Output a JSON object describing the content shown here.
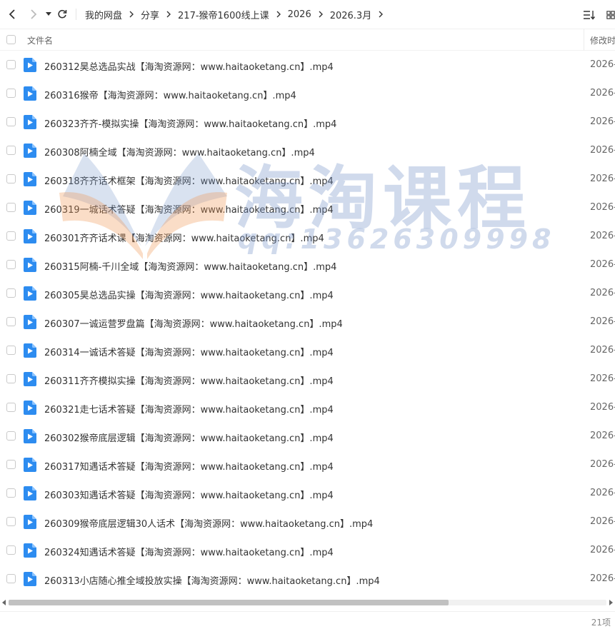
{
  "breadcrumb": [
    "我的网盘",
    "分享",
    "217-猴帝1600线上课",
    "2026",
    "2026.3月"
  ],
  "header": {
    "name_label": "文件名",
    "modified_label": "修改时"
  },
  "files": [
    {
      "name": "260312昊总选品实战【海淘资源网：www.haitaoketang.cn】.mp4",
      "date": "2026-0"
    },
    {
      "name": "260316猴帝【海淘资源网：www.haitaoketang.cn】.mp4",
      "date": "2026-0"
    },
    {
      "name": "260323齐齐-模拟实操【海淘资源网：www.haitaoketang.cn】.mp4",
      "date": "2026-0"
    },
    {
      "name": "260308阿楠全域【海淘资源网：www.haitaoketang.cn】.mp4",
      "date": "2026-0"
    },
    {
      "name": "260318齐齐话术框架【海淘资源网：www.haitaoketang.cn】.mp4",
      "date": "2026-0"
    },
    {
      "name": "260319一城话术答疑【海淘资源网：www.haitaoketang.cn】.mp4",
      "date": "2026-0"
    },
    {
      "name": "260301齐齐话术课【海淘资源网：www.haitaoketang.cn】.mp4",
      "date": "2026-0"
    },
    {
      "name": "260315阿楠-千川全域【海淘资源网：www.haitaoketang.cn】.mp4",
      "date": "2026-0"
    },
    {
      "name": "260305昊总选品实操【海淘资源网：www.haitaoketang.cn】.mp4",
      "date": "2026-0"
    },
    {
      "name": "260307一诚运营罗盘篇【海淘资源网：www.haitaoketang.cn】.mp4",
      "date": "2026-0"
    },
    {
      "name": "260314一诚话术答疑【海淘资源网：www.haitaoketang.cn】.mp4",
      "date": "2026-0"
    },
    {
      "name": "260311齐齐模拟实操【海淘资源网：www.haitaoketang.cn】.mp4",
      "date": "2026-0"
    },
    {
      "name": "260321走七话术答疑【海淘资源网：www.haitaoketang.cn】.mp4",
      "date": "2026-0"
    },
    {
      "name": "260302猴帝底层逻辑【海淘资源网：www.haitaoketang.cn】.mp4",
      "date": "2026-0"
    },
    {
      "name": "260317知遇话术答疑【海淘资源网：www.haitaoketang.cn】.mp4",
      "date": "2026-0"
    },
    {
      "name": "260303知遇话术答疑【海淘资源网：www.haitaoketang.cn】.mp4",
      "date": "2026-0"
    },
    {
      "name": "260309猴帝底层逻辑30人话术【海淘资源网：www.haitaoketang.cn】.mp4",
      "date": "2026-0"
    },
    {
      "name": "260324知遇话术答疑【海淘资源网：www.haitaoketang.cn】.mp4",
      "date": "2026-0"
    },
    {
      "name": "260313小店随心推全域投放实操【海淘资源网：www.haitaoketang.cn】.mp4",
      "date": "2026-0"
    }
  ],
  "footer": {
    "count": "21项"
  },
  "watermark": {
    "brand": "海淘课程",
    "qq": "qq:13626309998"
  },
  "colors": {
    "icon_blue": "#2d8cf0",
    "thumb": "#c1c1c1"
  },
  "icons": [
    "back-arrow-icon",
    "forward-arrow-icon",
    "dropdown-icon",
    "refresh-icon",
    "sort-icon",
    "grid-view-icon",
    "video-file-icon"
  ]
}
